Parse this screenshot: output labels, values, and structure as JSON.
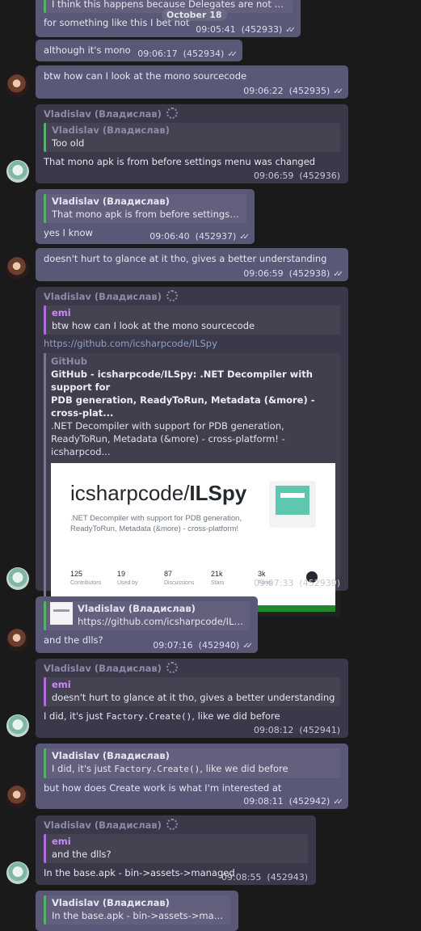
{
  "date_pill": "October 18",
  "messages": {
    "m1": {
      "quote_text": "I think this happens because Delegates are not assi...",
      "text": "for something like this I bet not",
      "time": "09:05:41",
      "id": "(452933)"
    },
    "m2": {
      "text": "although it's mono",
      "time": "09:06:17",
      "id": "(452934)"
    },
    "m3": {
      "text": "btw how can I look at the mono sourcecode",
      "time": "09:06:22",
      "id": "(452935)"
    },
    "m4": {
      "sender": "Vladislav (Владислав)",
      "quote_name": "Vladislav (Владислав)",
      "quote_text": "Too old",
      "text": "That mono apk is from before settings menu was changed",
      "time": "09:06:59",
      "id": "(452936)"
    },
    "m5": {
      "quote_name": "Vladislav (Владислав)",
      "quote_text": "That mono apk is from before settings m...",
      "text": "yes I know",
      "time": "09:06:40",
      "id": "(452937)"
    },
    "m6": {
      "text": "doesn't hurt to glance at it tho, gives a better understanding",
      "time": "09:06:59",
      "id": "(452938)"
    },
    "m7": {
      "sender": "Vladislav (Владислав)",
      "quote_name": "emi",
      "quote_text": "btw how can I look at the mono sourcecode",
      "link": "https://github.com/icsharpcode/ILSpy",
      "pv_site": "GitHub",
      "pv_title_1": "GitHub - icsharpcode/ILSpy: .NET Decompiler with support for",
      "pv_title_2": "PDB generation, ReadyToRun, Metadata (&more) - cross-plat...",
      "pv_desc_1": ".NET Decompiler with support for PDB generation,",
      "pv_desc_2": "ReadyToRun, Metadata (&more) - cross-platform! - icsharpcod...",
      "card_owner": "icsharpcode/",
      "card_repo": "ILSpy",
      "card_desc": ".NET Decompiler with support for PDB generation, ReadyToRun, Metadata (&more) - cross-platform!",
      "stats": [
        {
          "value": "125",
          "label": "Contributors"
        },
        {
          "value": "19",
          "label": "Used by"
        },
        {
          "value": "87",
          "label": "Discussions"
        },
        {
          "value": "21k",
          "label": "Stars"
        },
        {
          "value": "3k",
          "label": "Forks"
        }
      ],
      "time": "09:07:33",
      "id": "(452939)"
    },
    "m8": {
      "quote_name": "Vladislav (Владислав)",
      "quote_text": "https://github.com/icsharpcode/ILSpy",
      "text": "and the dlls?",
      "time": "09:07:16",
      "id": "(452940)"
    },
    "m9": {
      "sender": "Vladislav (Владислав)",
      "quote_name": "emi",
      "quote_text": "doesn't hurt to glance at it tho, gives a better understanding",
      "text_a": "I did, it's just ",
      "code": "Factory.Create()",
      "text_b": ", like we did before",
      "time": "09:08:12",
      "id": "(452941)"
    },
    "m10": {
      "quote_name": "Vladislav (Владислав)",
      "quote_a": "I did, it's just ",
      "quote_code": "Factory.Create()",
      "quote_b": ", like we did before",
      "text": "but how does Create work is what I'm interested at",
      "time": "09:08:11",
      "id": "(452942)"
    },
    "m11": {
      "sender": "Vladislav (Владислав)",
      "quote_name": "emi",
      "quote_text": "and the dlls?",
      "text": "In the base.apk - bin->assets->managed",
      "time": "09:08:55",
      "id": "(452943)"
    },
    "m12": {
      "quote_name": "Vladislav (Владислав)",
      "quote_text": "In the base.apk - bin->assets->managed"
    }
  },
  "checks": "✓✓"
}
